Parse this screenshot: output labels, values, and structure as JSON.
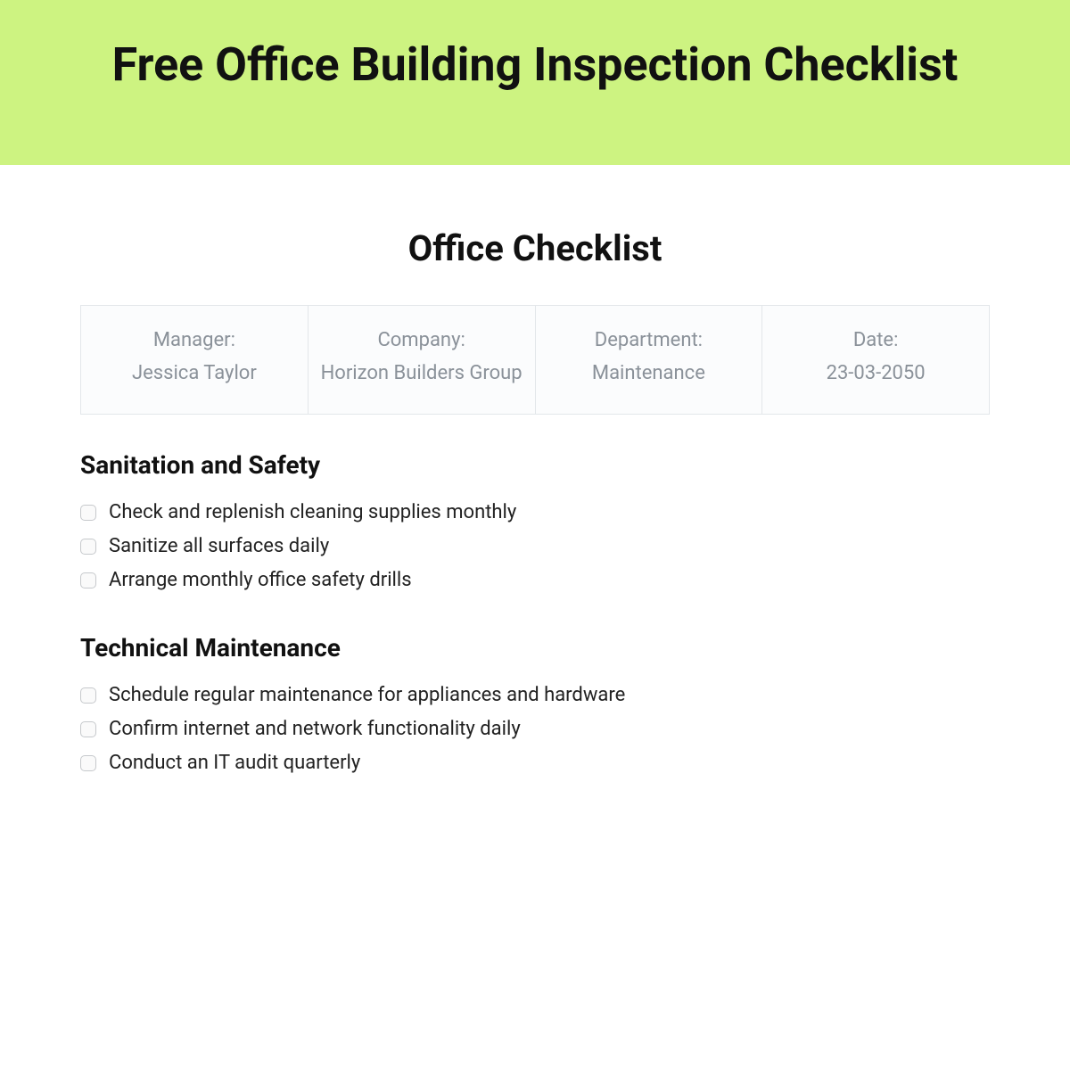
{
  "banner": {
    "title": "Free Office Building Inspection Checklist"
  },
  "doc": {
    "title": "Office Checklist",
    "info": [
      {
        "label": "Manager:",
        "value": "Jessica Taylor"
      },
      {
        "label": "Company:",
        "value": "Horizon Builders Group"
      },
      {
        "label": "Department:",
        "value": "Maintenance"
      },
      {
        "label": "Date:",
        "value": "23-03-2050"
      }
    ],
    "sections": [
      {
        "heading": "Sanitation and Safety",
        "items": [
          "Check and replenish cleaning supplies monthly",
          "Sanitize all surfaces daily",
          "Arrange monthly office safety drills"
        ]
      },
      {
        "heading": "Technical Maintenance",
        "items": [
          "Schedule regular maintenance for appliances and hardware",
          "Confirm internet and network functionality daily",
          "Conduct an IT audit quarterly"
        ]
      }
    ]
  }
}
